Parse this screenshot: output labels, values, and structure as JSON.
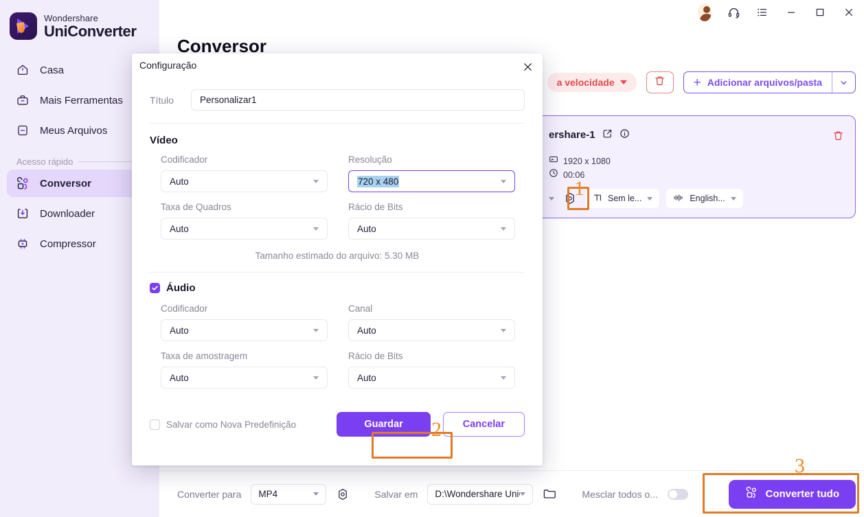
{
  "sidebar": {
    "brand": {
      "top": "Wondershare",
      "bottom": "UniConverter"
    },
    "items": [
      {
        "label": "Casa",
        "icon": "home-icon"
      },
      {
        "label": "Mais Ferramentas",
        "icon": "toolbox-icon"
      },
      {
        "label": "Meus Arquivos",
        "icon": "files-icon"
      }
    ],
    "section_label": "Acesso rápido",
    "quick_items": [
      {
        "label": "Conversor",
        "icon": "converter-icon",
        "active": true
      },
      {
        "label": "Downloader",
        "icon": "download-icon",
        "active": false
      },
      {
        "label": "Compressor",
        "icon": "compressor-icon",
        "active": false
      }
    ]
  },
  "window_controls": {
    "avatar": "user-avatar",
    "headset": "headset-icon",
    "menu": "list-menu-icon",
    "minimize": "minimize-icon",
    "maximize": "maximize-icon",
    "close": "close-icon"
  },
  "page": {
    "title": "Conversor"
  },
  "toolbar": {
    "speed_label": "a velocidade",
    "delete_icon": "trash-icon",
    "add_label": "Adicionar arquivos/pasta",
    "add_plus": "+",
    "add_chevron": "chevron-down-icon"
  },
  "file_card": {
    "name": "ershare-1",
    "edit_icon": "edit-icon",
    "info_icon": "info-icon",
    "resolution": "1920 x 1080",
    "duration": "00:06",
    "trash_icon": "trash-icon",
    "controls": [
      {
        "label": "Sem le...",
        "icon": "subtitle-icon"
      },
      {
        "label": "English...",
        "icon": "audio-wave-icon"
      }
    ],
    "settings_icon": "gear-target-icon"
  },
  "bottom_bar": {
    "convert_to_label": "Converter para",
    "format_value": "MP4",
    "format_settings_icon": "gear-target-icon",
    "save_in_label": "Salvar em",
    "save_path": "D:\\Wondershare UniCo",
    "folder_icon": "folder-icon",
    "merge_label": "Mesclar todos o...",
    "merge_on": false,
    "convert_all_label": "Converter tudo",
    "convert_all_icon": "converter-icon"
  },
  "dialog": {
    "title": "Configuração",
    "close_icon": "close-icon",
    "title_field": {
      "label": "Título",
      "value": "Personalizar1",
      "placeholder": "Personalizar1"
    },
    "video": {
      "section": "Vídeo",
      "encoder": {
        "label": "Codificador",
        "value": "Auto"
      },
      "resolution": {
        "label": "Resolução",
        "value": "720 x 480",
        "focused": true,
        "text_selected": true
      },
      "framerate": {
        "label": "Taxa de Quadros",
        "value": "Auto"
      },
      "bitrate": {
        "label": "Rácio de Bits",
        "value": "Auto"
      },
      "estimate": "Tamanho estimado do arquivo: 5.30 MB"
    },
    "audio": {
      "section": "Áudio",
      "checked": true,
      "encoder": {
        "label": "Codificador",
        "value": "Auto"
      },
      "channel": {
        "label": "Canal",
        "value": "Auto"
      },
      "samplerate": {
        "label": "Taxa de amostragem",
        "value": "Auto"
      },
      "bitrate": {
        "label": "Rácio de Bits",
        "value": "Auto"
      }
    },
    "save_preset": {
      "label": "Salvar como Nova Predefinição",
      "checked": false
    },
    "save_button": "Guardar",
    "cancel_button": "Cancelar"
  },
  "annotations": {
    "step1": "1",
    "step2": "2",
    "step3": "3",
    "color": "#e07b26"
  }
}
